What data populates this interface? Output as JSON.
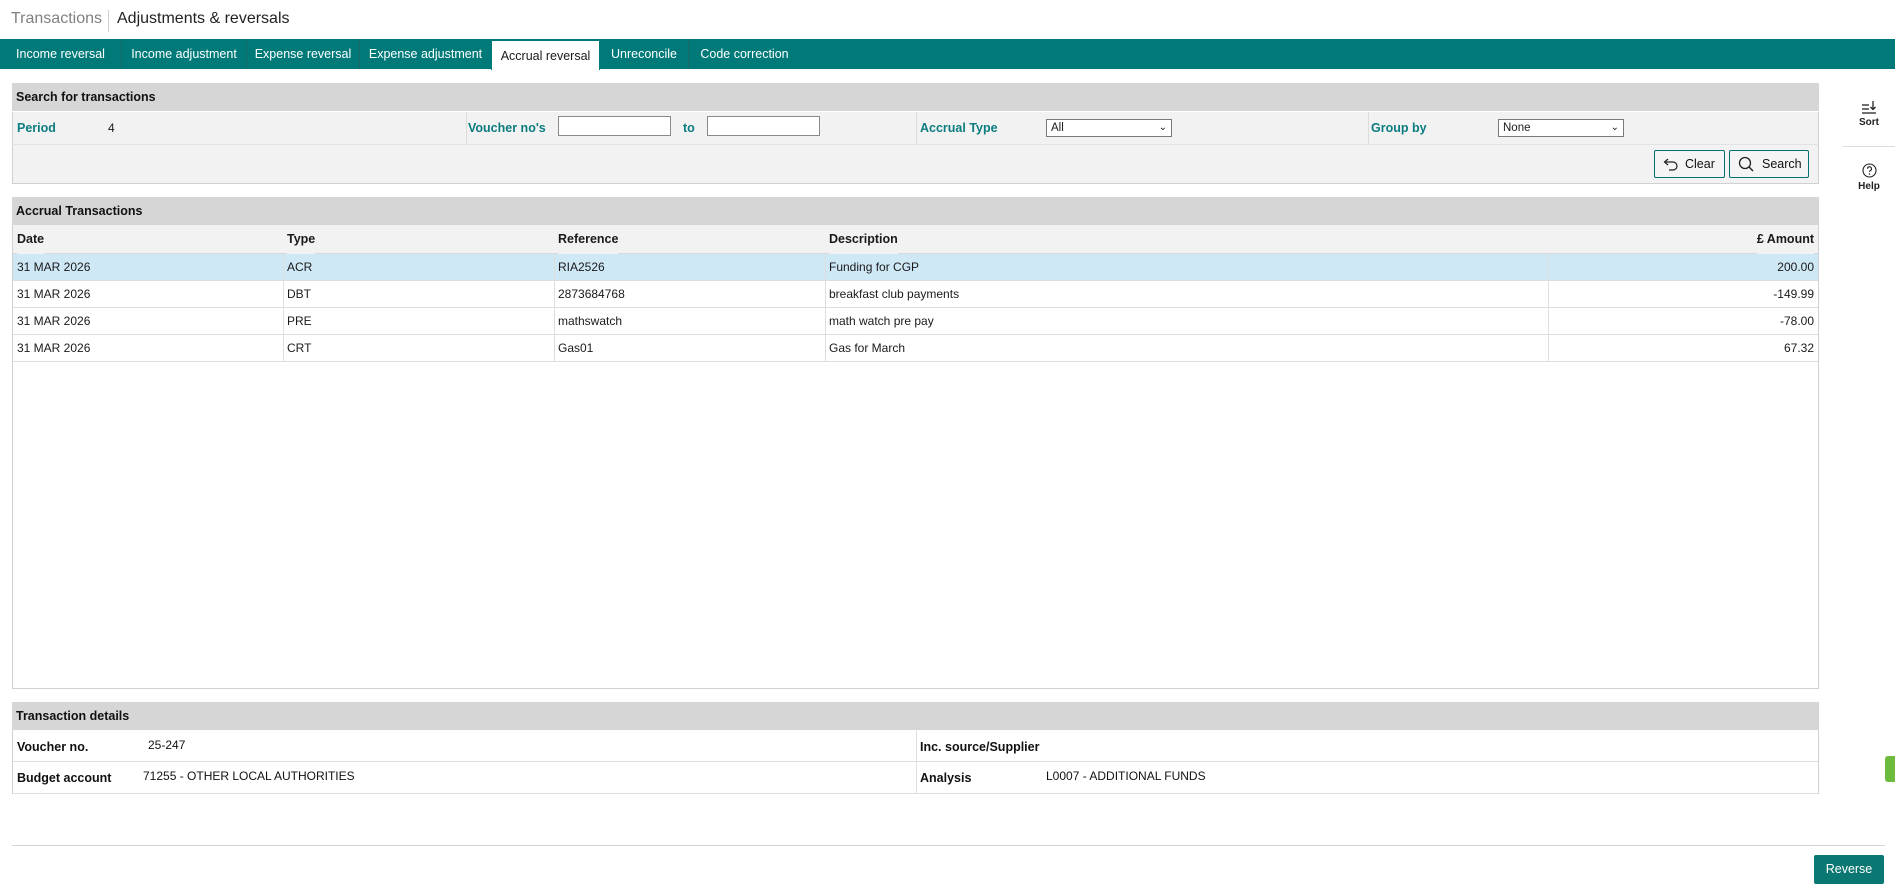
{
  "header": {
    "breadcrumb_parent": "Transactions",
    "title": "Adjustments & reversals"
  },
  "tabs": [
    {
      "label": "Income reversal"
    },
    {
      "label": "Income adjustment"
    },
    {
      "label": "Expense reversal"
    },
    {
      "label": "Expense adjustment"
    },
    {
      "label": "Accrual reversal",
      "active": true
    },
    {
      "label": "Unreconcile"
    },
    {
      "label": "Code correction"
    }
  ],
  "search": {
    "title": "Search for transactions",
    "period_label": "Period",
    "period_value": "4",
    "voucher_label": "Voucher no's",
    "voucher_from": "",
    "to_label": "to",
    "voucher_to": "",
    "accrual_type_label": "Accrual Type",
    "accrual_type_value": "All",
    "group_by_label": "Group by",
    "group_by_value": "None",
    "clear_label": "Clear",
    "search_label": "Search"
  },
  "transactions": {
    "title": "Accrual Transactions",
    "columns": [
      "Date",
      "Type",
      "Reference",
      "Description",
      "£ Amount"
    ],
    "rows": [
      [
        "31 MAR 2026",
        "ACR",
        "RIA2526",
        "Funding for CGP",
        "200.00"
      ],
      [
        "31 MAR 2026",
        "DBT",
        "2873684768",
        "breakfast club payments",
        "-149.99"
      ],
      [
        "31 MAR 2026",
        "PRE",
        "mathswatch",
        "math watch pre pay",
        "-78.00"
      ],
      [
        "31 MAR 2026",
        "CRT",
        "Gas01",
        "Gas for March",
        "67.32"
      ]
    ],
    "selected_row": 0
  },
  "details": {
    "title": "Transaction details",
    "voucher_label": "Voucher no.",
    "voucher_value": "25-247",
    "supplier_label": "Inc. source/Supplier",
    "supplier_value": "",
    "budget_label": "Budget account",
    "budget_value": "71255 - OTHER LOCAL AUTHORITIES",
    "analysis_label": "Analysis",
    "analysis_value": "L0007 - ADDITIONAL FUNDS"
  },
  "actions": {
    "reverse_label": "Reverse"
  },
  "sidebar": {
    "sort_label": "Sort",
    "help_label": "Help"
  },
  "colors": {
    "brand_teal": "#007a79",
    "label_teal": "#0b7c80",
    "selected_row": "#cfe8f6"
  },
  "icons": [
    "undo-icon",
    "search-icon",
    "sort-icon",
    "help-icon"
  ]
}
